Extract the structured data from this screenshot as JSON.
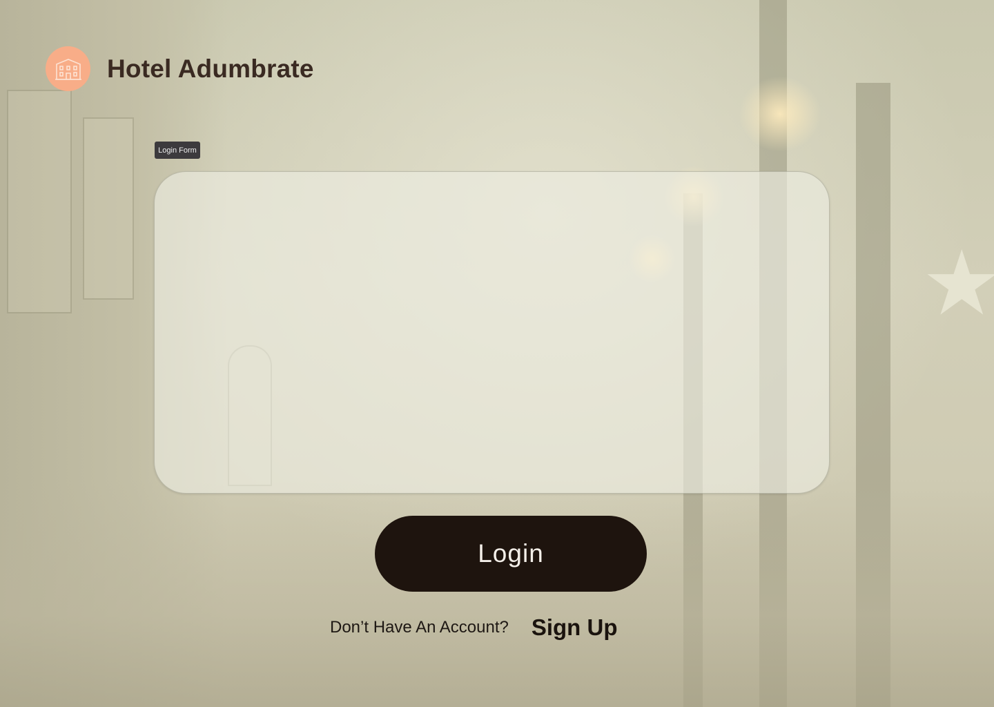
{
  "brand": {
    "name": "Hotel Adumbrate",
    "logo_icon": "hotel-building-icon",
    "logo_color": "#f8ad88"
  },
  "login_form": {
    "tag_label": "Login Form"
  },
  "actions": {
    "login_label": "Login",
    "signup_prompt": "Don’t Have An Account?",
    "signup_label": "Sign Up"
  },
  "colors": {
    "button_bg": "#1e140e",
    "text_dark": "#3a2a22"
  }
}
